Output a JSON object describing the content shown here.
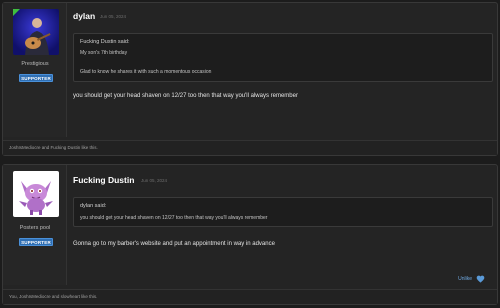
{
  "posts": [
    {
      "username": "dylan",
      "date": "Jun 05, 2024",
      "user_title": "Prestigious",
      "badge": "SUPPORTER",
      "quote": {
        "author": "Fucking Dustin said:",
        "lines": [
          "My son's 7th birthday",
          "Glad to know he shares it with such a momentous occasion"
        ]
      },
      "message": "you should get your head shaven on 12/27 too then that way you'll always remember",
      "reactions": "JoshIsMediocre and Fucking Dustin like this."
    },
    {
      "username": "Fucking Dustin",
      "date": "Jun 05, 2024",
      "user_title": "Posters pool",
      "badge": "SUPPORTER",
      "quote": {
        "author": "dylan said:",
        "lines": [
          "you should get your head shaven on 12/27 too then that way you'll always remember"
        ]
      },
      "message": "Gonna go to my barber's website and put an appointment in way in advance",
      "unlike_label": "Unlike",
      "reactions": "You, JoshIsMediocre and slowheart like this."
    }
  ],
  "colors": {
    "background": "#1c1c1c",
    "card": "#242424",
    "badge": "#2f6fb4",
    "link": "#6fa8e0",
    "online": "#3fbf3f"
  },
  "icons": [
    "online-indicator-icon",
    "heart-icon"
  ]
}
